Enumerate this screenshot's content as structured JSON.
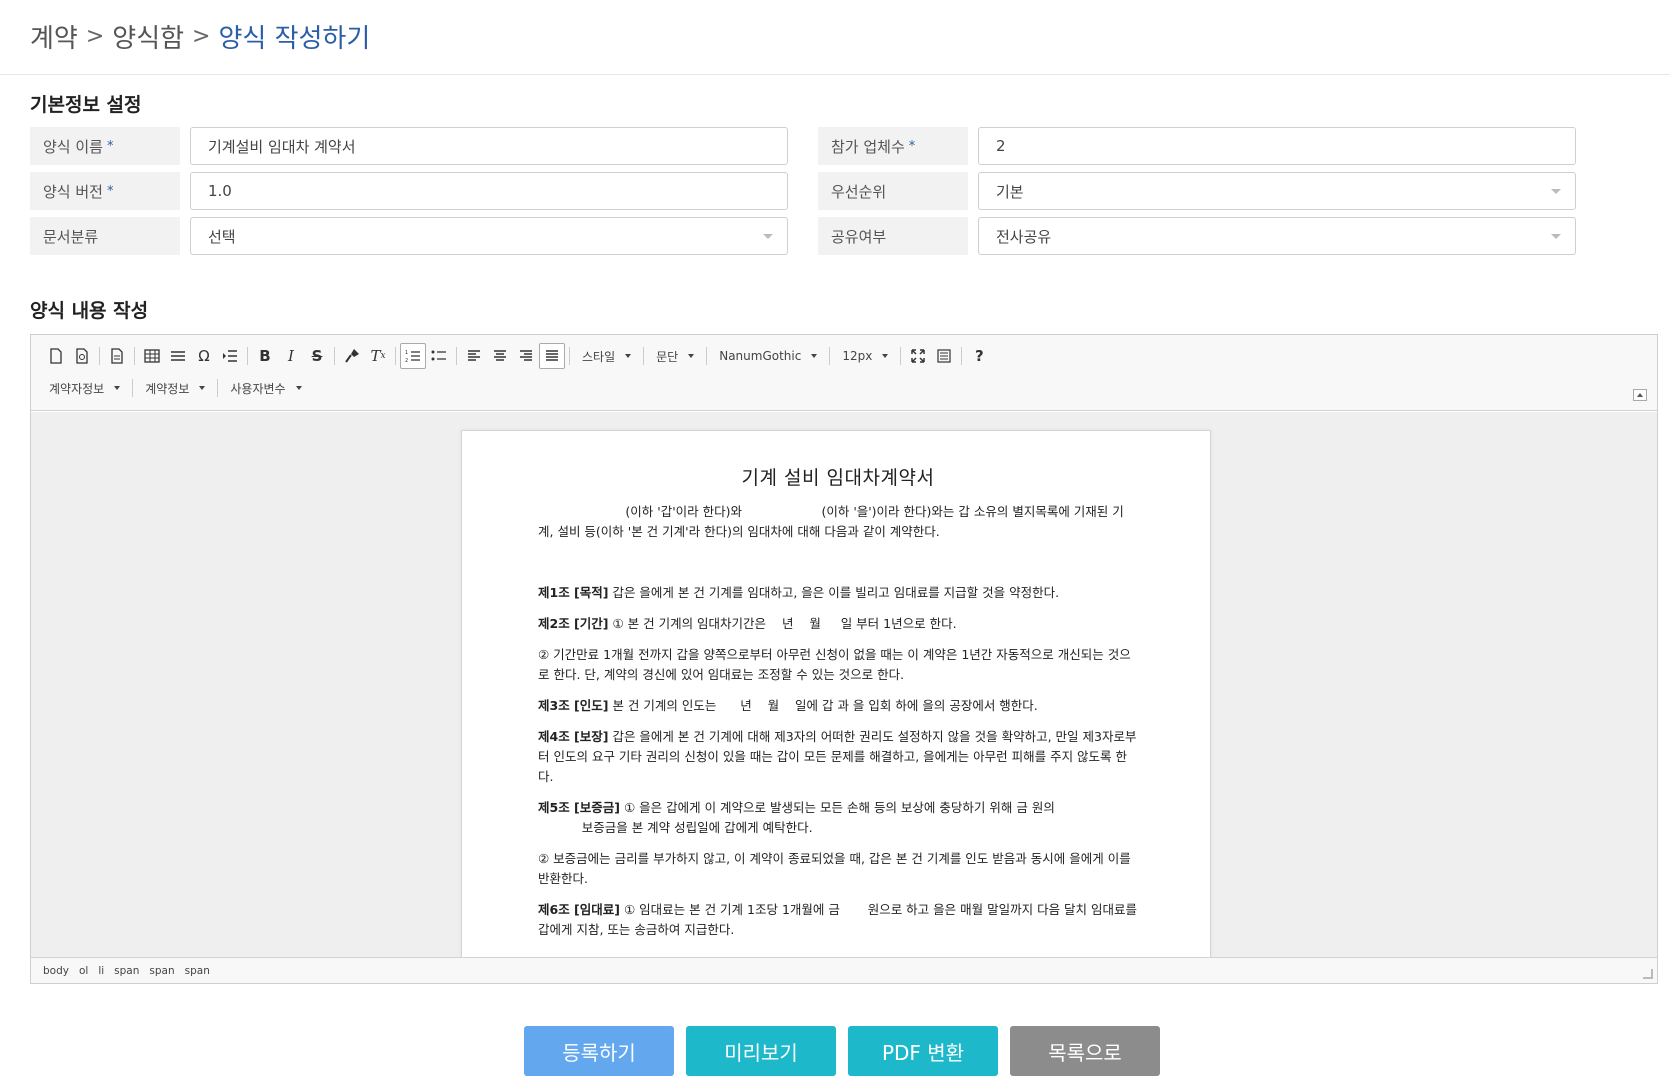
{
  "breadcrumb": {
    "items": [
      "계약",
      "양식함"
    ],
    "current": "양식 작성하기",
    "separator": ">"
  },
  "basic_info": {
    "title": "기본정보 설정",
    "form_name_label": "양식 이름",
    "form_name_value": "기계설비 임대차 계약서",
    "participants_label": "참가 업체수",
    "participants_value": "2",
    "version_label": "양식 버전",
    "version_value": "1.0",
    "priority_label": "우선순위",
    "priority_value": "기본",
    "category_label": "문서분류",
    "category_value": "선택",
    "sharing_label": "공유여부",
    "sharing_value": "전사공유",
    "required_mark": "*"
  },
  "editor": {
    "title": "양식 내용 작성",
    "toolbar": {
      "style_label": "스타일",
      "paragraph_label": "문단",
      "font_label": "NanumGothic",
      "size_label": "12px",
      "contractor_info_label": "계약자정보",
      "contract_info_label": "계약정보",
      "user_var_label": "사용자변수",
      "help_label": "?"
    },
    "document": {
      "title": "기계 설비 임대차계약서",
      "intro": "                      (이하 '갑'이라 한다)와                    (이하 '을')이라 한다)와는 갑 소유의 별지목록에 기재된 기계, 설비 등(이하 '본 건 기계'라 한다)의 임대차에 대해 다음과 같이 계약한다.",
      "articles": [
        {
          "head": "제1조 [목적]",
          "text": " 갑은 을에게 본 건 기계를 임대하고, 을은 이를 빌리고 임대료를 지급할 것을 약정한다."
        },
        {
          "head": "제2조 [기간]",
          "text": " ① 본 건 기계의 임대차기간은    년    월     일 부터 1년으로 한다."
        },
        {
          "head": "",
          "text": "② 기간만료 1개월 전까지 갑을 양쪽으로부터 아무런 신청이 없을 때는 이 계약은 1년간 자동적으로 개신되는 것으로 한다. 단, 계약의 경신에 있어 임대료는 조정할 수 있는 것으로 한다."
        },
        {
          "head": "제3조 [인도]",
          "text": " 본 건 기계의 인도는      년    월    일에 갑 과 을 입회 하에 을의 공장에서 행한다."
        },
        {
          "head": "제4조 [보장]",
          "text": " 갑은 을에게 본 건 기계에 대해 제3자의 어떠한 권리도 설정하지 않을 것을 확약하고, 만일 제3자로부터 인도의 요구 기타 권리의 신청이 있을 때는 갑이 모든 문제를 해결하고, 을에게는 아무런 피해를 주지 않도록 한다."
        },
        {
          "head": "제5조 [보증금]",
          "text": " ① 을은 갑에게 이 계약으로 발생되는 모든 손해 등의 보상에 충당하기 위해 금 원의\n           보증금을 본 계약 성립일에 갑에게 예탁한다."
        },
        {
          "head": "",
          "text": "② 보증금에는 금리를 부가하지 않고, 이 계약이 종료되었을 때, 갑은 본 건 기계를 인도 받음과 동시에 을에게 이를 반환한다."
        },
        {
          "head": "제6조 [임대료]",
          "text": " ① 임대료는 본 건 기계 1조당 1개월에 금       원으로 하고 을은 매월 말일까지 다음 달치 임대료를 갑에게 지참, 또는 송금하여 지급한다."
        }
      ]
    },
    "status_path": [
      "body",
      "ol",
      "li",
      "span",
      "span",
      "span"
    ]
  },
  "actions": {
    "register": "등록하기",
    "preview": "미리보기",
    "pdf": "PDF 변환",
    "list": "목록으로"
  }
}
